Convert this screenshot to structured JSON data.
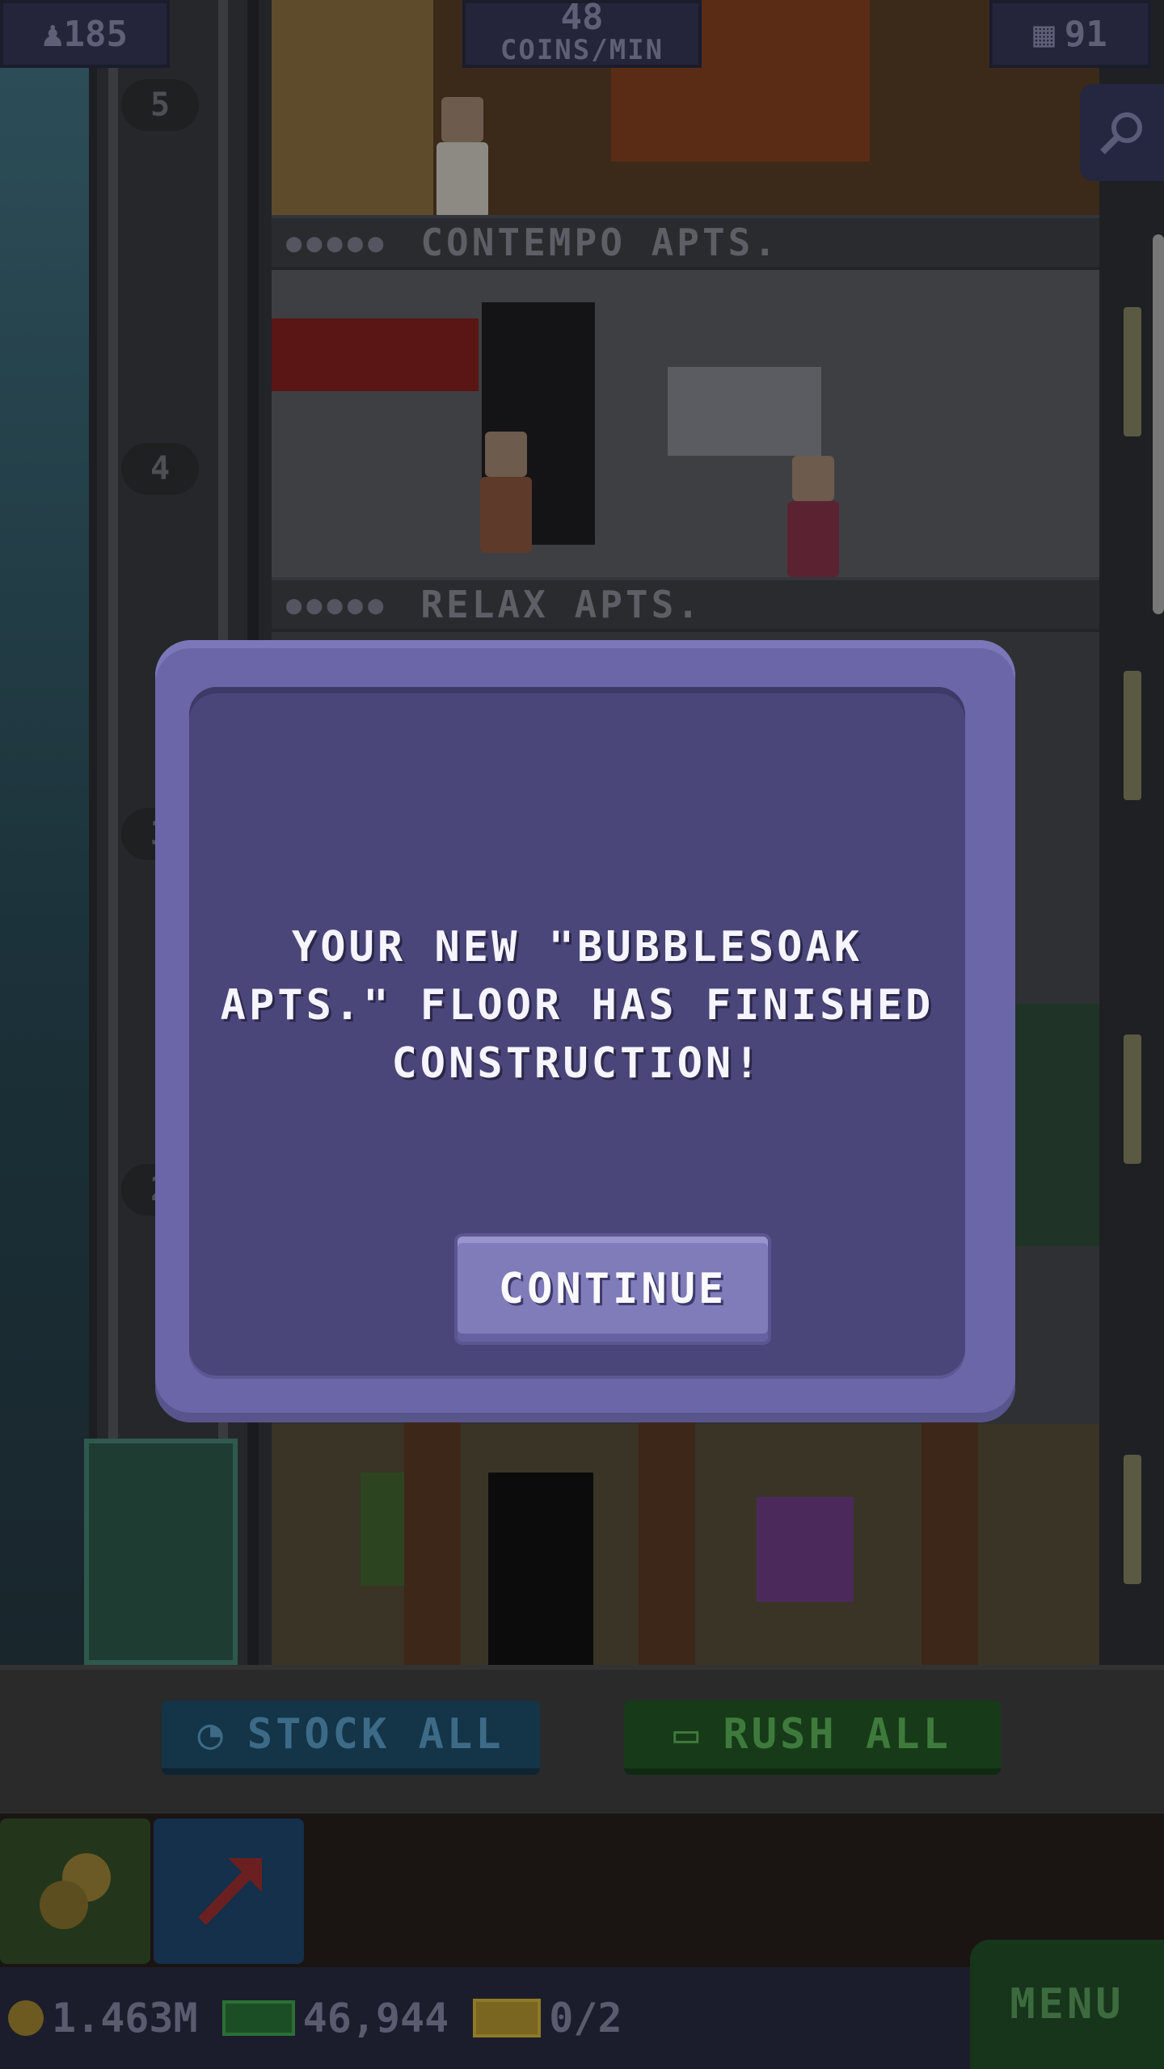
{
  "hud": {
    "population": "185",
    "coins_rate": "48",
    "coins_rate_unit": "COINS/MIN",
    "floors": "91",
    "search_icon": "magnifier-icon"
  },
  "tower": {
    "shaft_markers": [
      "5",
      "4",
      "3",
      "2"
    ],
    "floors": [
      {
        "name": "CONTEMPO APTS.",
        "stars": "●●●●●"
      },
      {
        "name": "RELAX APTS.",
        "stars": "●●●●●"
      }
    ]
  },
  "actions": {
    "stock_all": "STOCK ALL",
    "rush_all": "RUSH ALL"
  },
  "status": {
    "coins": "1.463M",
    "bux": "46,944",
    "tickets": "0/2",
    "menu": "MENU"
  },
  "dialog": {
    "message": "YOUR NEW \"BUBBLESOAK APTS.\" FLOOR HAS FINISHED CONSTRUCTION!",
    "continue_label": "CONTINUE"
  },
  "colors": {
    "dialog_outer": "#6b66a7",
    "dialog_inner": "#4a4679",
    "button": "#807cba",
    "stock_all": "#143447",
    "rush_all": "#173b18"
  }
}
